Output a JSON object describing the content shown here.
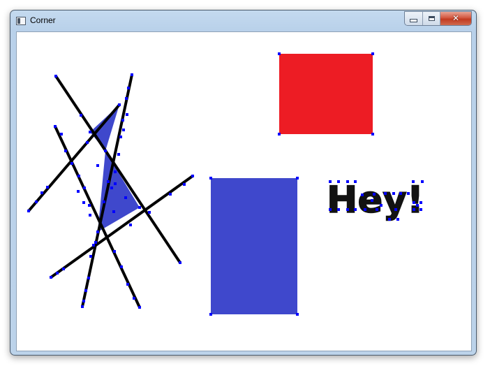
{
  "window": {
    "title": "Corner",
    "buttons": {
      "minimize": "minimize",
      "maximize": "maximize",
      "close": "close"
    }
  },
  "canvas": {
    "text": "Hey!",
    "colors": {
      "red_rect": "#ed1c24",
      "blue_shape": "#3f48cc",
      "lines": "#000000",
      "corner_markers": "#0000ff"
    }
  }
}
